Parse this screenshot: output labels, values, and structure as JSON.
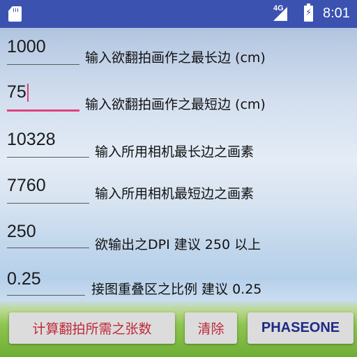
{
  "status_bar": {
    "network_label": "4G",
    "time": "8:01",
    "icons": [
      "sd-card-icon",
      "signal-icon",
      "battery-icon"
    ]
  },
  "form": {
    "fields": [
      {
        "value": "1000",
        "label": "输入欲翻拍画作之最长边 (cm)",
        "focused": false
      },
      {
        "value": "75",
        "label": "输入欲翻拍画作之最短边 (cm)",
        "focused": true
      },
      {
        "value": "10328",
        "label": "输入所用相机最长边之画素",
        "focused": false
      },
      {
        "value": "7760",
        "label": "输入所用相机最短边之画素",
        "focused": false
      },
      {
        "value": "250",
        "label": "欲输出之DPI 建议 250 以上",
        "focused": false
      },
      {
        "value": "0.25",
        "label": "接图重叠区之比例 建议 0.25",
        "focused": false
      }
    ]
  },
  "buttons": {
    "calculate": "计算翻拍所需之张数",
    "clear": "清除",
    "phaseone": "PHASEONE"
  },
  "colors": {
    "status_bar": "#3b52b0",
    "focus_accent": "#e0407f",
    "calculate_text": "#c0283a",
    "clear_text": "#c0283a",
    "phaseone_text": "#1d2a86",
    "button_bg": "#dcdcdc"
  }
}
